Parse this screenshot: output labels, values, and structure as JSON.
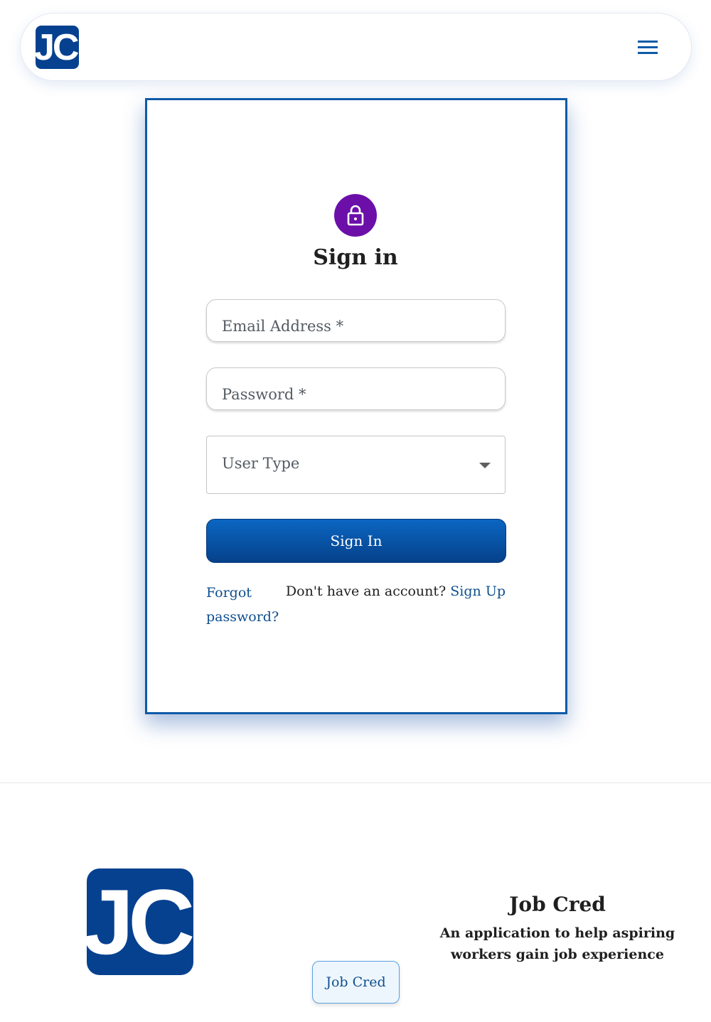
{
  "header": {
    "logo_text": "JC",
    "menu_icon": "hamburger-menu-icon"
  },
  "signin": {
    "lock_icon": "lock-icon",
    "title": "Sign in",
    "email_placeholder": "Email Address *",
    "password_placeholder": "Password *",
    "user_type_placeholder": "User Type",
    "submit_label": "Sign In",
    "forgot_label": "Forgot password?",
    "no_account_text": "Don't have an account?",
    "signup_label": "Sign Up"
  },
  "footer": {
    "logo_text": "JC",
    "chip_label": "Job Cred",
    "app_name": "Job Cred",
    "tagline": "An application to help aspiring workers gain job experience"
  },
  "colors": {
    "brand_blue": "#064190",
    "button_blue": "#0b66c2",
    "lock_purple": "#6c0fa8",
    "link_blue": "#0e4f8f"
  }
}
